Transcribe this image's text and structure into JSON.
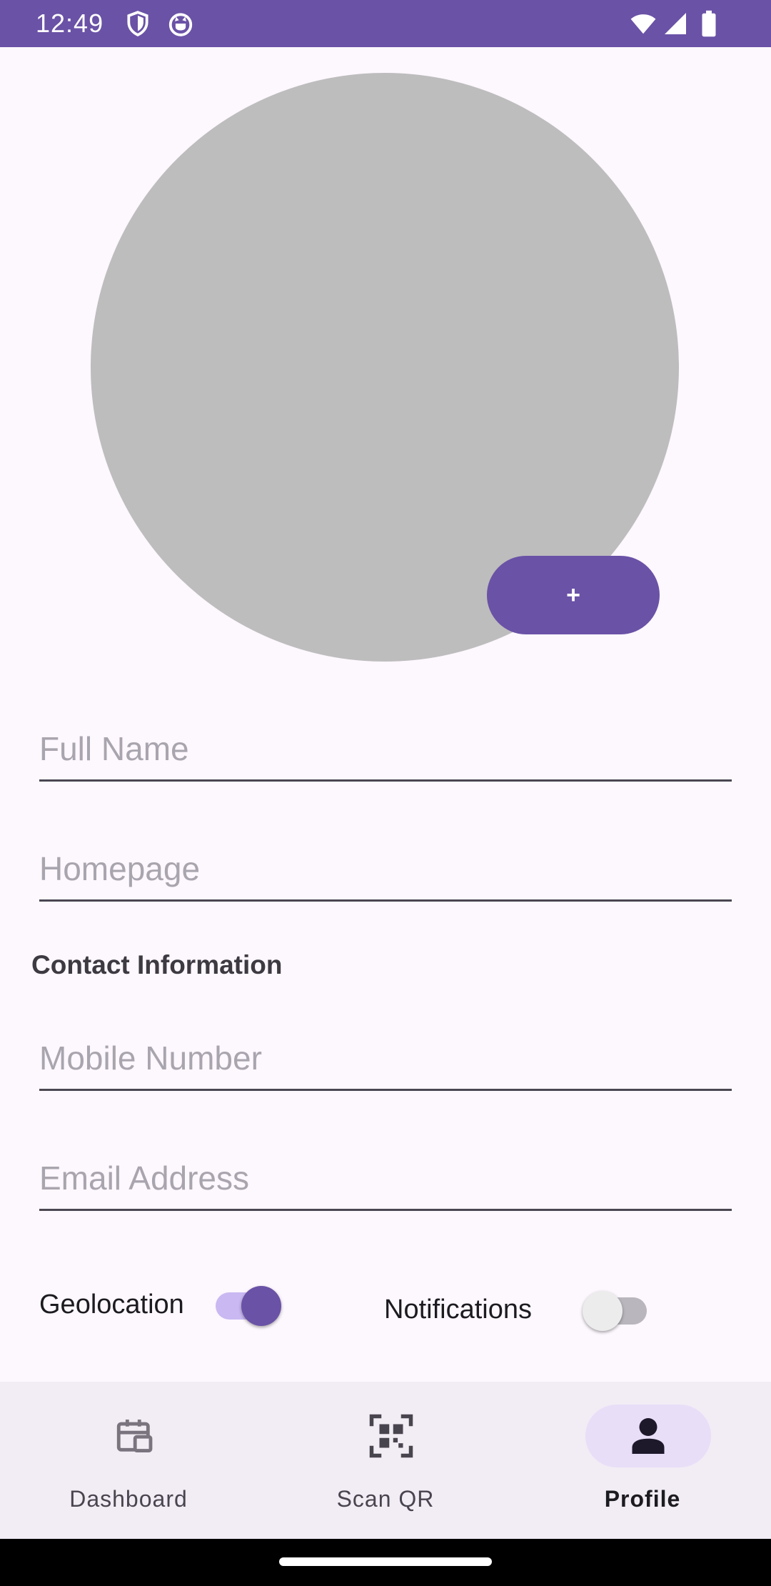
{
  "status_bar": {
    "time": "12:49",
    "left_icons": [
      "shield-icon",
      "cat-icon"
    ],
    "right_icons": [
      "wifi-icon",
      "cellular-signal-icon",
      "battery-icon"
    ],
    "color": "#6A52A6"
  },
  "profile": {
    "add_photo_label": "+",
    "fields": {
      "full_name": {
        "placeholder": "Full Name",
        "value": ""
      },
      "homepage": {
        "placeholder": "Homepage",
        "value": ""
      },
      "mobile_number": {
        "placeholder": "Mobile Number",
        "value": ""
      },
      "email_address": {
        "placeholder": "Email Address",
        "value": ""
      }
    },
    "contact_section_title": "Contact Information",
    "toggles": {
      "geolocation": {
        "label": "Geolocation",
        "on": true
      },
      "notifications": {
        "label": "Notifications",
        "on": false
      }
    }
  },
  "bottom_nav": {
    "items": [
      {
        "label": "Dashboard",
        "icon": "dashboard-icon",
        "active": false
      },
      {
        "label": "Scan QR",
        "icon": "qr-scan-icon",
        "active": false
      },
      {
        "label": "Profile",
        "icon": "person-icon",
        "active": true
      }
    ]
  },
  "colors": {
    "accent": "#6A52A6",
    "background": "#FDF7FE",
    "nav_background": "#F2ECF5",
    "active_pill": "#E8DEF8",
    "avatar_placeholder": "#BDBDBD"
  }
}
